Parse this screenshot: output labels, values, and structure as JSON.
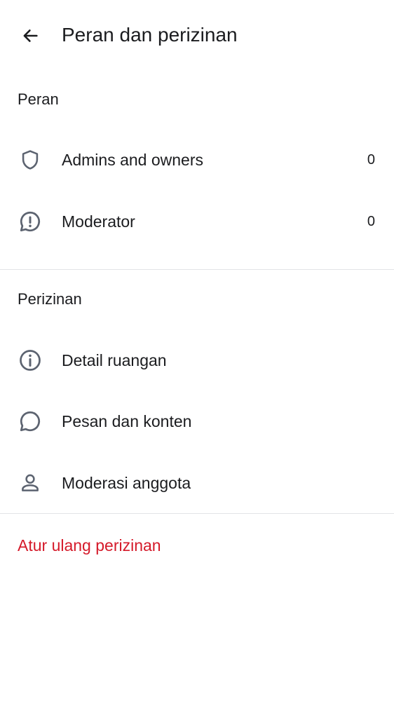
{
  "header": {
    "title": "Peran dan perizinan",
    "back_icon": "arrow-left-icon"
  },
  "roles_section": {
    "title": "Peran",
    "items": [
      {
        "label": "Admins and owners",
        "count": "0",
        "icon": "shield-icon"
      },
      {
        "label": "Moderator",
        "count": "0",
        "icon": "alert-chat-icon"
      }
    ]
  },
  "permissions_section": {
    "title": "Perizinan",
    "items": [
      {
        "label": "Detail ruangan",
        "icon": "info-icon"
      },
      {
        "label": "Pesan dan konten",
        "icon": "chat-bubble-icon"
      },
      {
        "label": "Moderasi anggota",
        "icon": "person-icon"
      }
    ]
  },
  "reset": {
    "label": "Atur ulang perizinan",
    "color": "#d51a2a"
  },
  "colors": {
    "text": "#1b1c1f",
    "icon": "#5c6370",
    "divider": "#e3e4e6",
    "danger": "#d51a2a"
  }
}
